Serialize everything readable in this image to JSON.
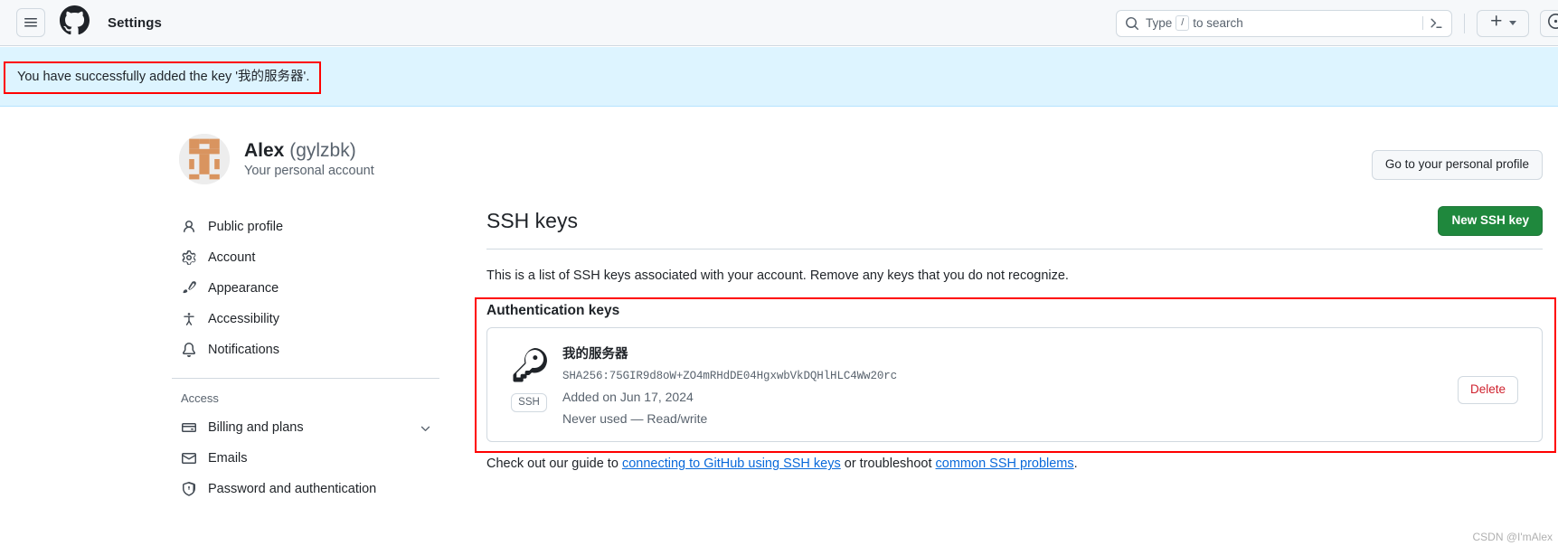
{
  "header": {
    "menu_icon": "hamburger-icon",
    "logo_icon": "github-mark-icon",
    "title": "Settings",
    "search": {
      "placeholder_prefix": "Type",
      "slash_key": "/",
      "placeholder_suffix": "to search",
      "search_icon": "search-icon",
      "terminal_icon": "terminal-icon"
    },
    "create_new": {
      "plus_icon": "plus-icon",
      "caret_icon": "chevron-down-icon"
    },
    "issues_icon": "issue-opened-icon"
  },
  "flash": {
    "message": "You have successfully added the key '我的服务器'.",
    "background": "#ddf4ff",
    "annotation_color": "#ff0000"
  },
  "sidebar": {
    "account": {
      "name": "Alex",
      "handle": "(gylzbk)",
      "subtitle": "Your personal account",
      "avatar": "avatar-identicon"
    },
    "items": [
      {
        "label": "Public profile",
        "icon": "person-icon"
      },
      {
        "label": "Account",
        "icon": "gear-icon"
      },
      {
        "label": "Appearance",
        "icon": "paintbrush-icon"
      },
      {
        "label": "Accessibility",
        "icon": "accessibility-icon"
      },
      {
        "label": "Notifications",
        "icon": "bell-icon"
      }
    ],
    "section_title": "Access",
    "access_items": [
      {
        "label": "Billing and plans",
        "icon": "credit-card-icon",
        "expandable": true
      },
      {
        "label": "Emails",
        "icon": "mail-icon",
        "expandable": false
      },
      {
        "label": "Password and authentication",
        "icon": "shield-lock-icon",
        "expandable": false
      }
    ]
  },
  "main": {
    "profile_button": "Go to your personal profile",
    "title": "SSH keys",
    "new_key_button": "New SSH key",
    "new_key_button_color": "#1f883d",
    "description": "This is a list of SSH keys associated with your account. Remove any keys that you do not recognize.",
    "keys_section_title": "Authentication keys",
    "key": {
      "icon": "key-icon",
      "badge": "SSH",
      "name": "我的服务器",
      "fingerprint": "SHA256:75GIR9d8oW+ZO4mRHdDE04HgxwbVkDQHlHLC4Ww20rc",
      "added": "Added on Jun 17, 2024",
      "usage": "Never used — Read/write",
      "delete_button": "Delete",
      "delete_button_color": "#cf222e"
    },
    "footer": {
      "prefix": "Check out our guide to ",
      "link1": "connecting to GitHub using SSH keys",
      "middle": " or troubleshoot ",
      "link2": "common SSH problems",
      "suffix": "."
    }
  },
  "watermark": "CSDN @I'mAlex"
}
